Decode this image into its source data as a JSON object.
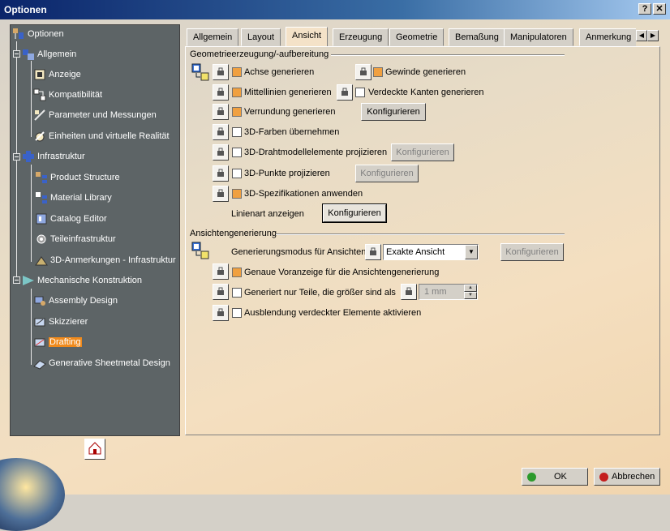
{
  "window": {
    "title": "Optionen",
    "help_button": "?",
    "close_button": "✕"
  },
  "tree": {
    "items": [
      {
        "label": "Optionen",
        "level": 0
      },
      {
        "label": "Allgemein",
        "level": 1
      },
      {
        "label": "Anzeige",
        "level": 2
      },
      {
        "label": "Kompatibilität",
        "level": 2
      },
      {
        "label": "Parameter und Messungen",
        "level": 2
      },
      {
        "label": "Einheiten und virtuelle Realität",
        "level": 2
      },
      {
        "label": "Infrastruktur",
        "level": 1
      },
      {
        "label": "Product Structure",
        "level": 2
      },
      {
        "label": "Material Library",
        "level": 2
      },
      {
        "label": "Catalog Editor",
        "level": 2
      },
      {
        "label": "Teileinfrastruktur",
        "level": 2
      },
      {
        "label": "3D-Anmerkungen - Infrastruktur",
        "level": 2
      },
      {
        "label": "Mechanische Konstruktion",
        "level": 1
      },
      {
        "label": "Assembly Design",
        "level": 2
      },
      {
        "label": "Skizzierer",
        "level": 2
      },
      {
        "label": "Drafting",
        "level": 2,
        "selected": true
      },
      {
        "label": "Generative Sheetmetal Design",
        "level": 2
      }
    ]
  },
  "tabs": [
    {
      "label": "Allgemein"
    },
    {
      "label": "Layout"
    },
    {
      "label": "Ansicht",
      "active": true
    },
    {
      "label": "Erzeugung"
    },
    {
      "label": "Geometrie"
    },
    {
      "label": "Bemaßung"
    },
    {
      "label": "Manipulatoren"
    },
    {
      "label": "Anmerkung"
    }
  ],
  "geometry_section": {
    "title": "Geometrieerzeugung/-aufbereitung",
    "options": {
      "achse": {
        "label": "Achse generieren",
        "checked": true
      },
      "gewinde": {
        "label": "Gewinde generieren",
        "checked": true
      },
      "mittellinien": {
        "label": "Mittellinien generieren",
        "checked": true
      },
      "verdeckte_kanten": {
        "label": "Verdeckte Kanten generieren",
        "checked": false
      },
      "verrundung": {
        "label": "Verrundung generieren",
        "checked": true
      },
      "farben": {
        "label": "3D-Farben übernehmen",
        "checked": false
      },
      "draht": {
        "label": "3D-Drahtmodellelemente projizieren",
        "checked": false
      },
      "punkte": {
        "label": "3D-Punkte projizieren",
        "checked": false
      },
      "spezifikationen": {
        "label": "3D-Spezifikationen anwenden",
        "checked": true
      }
    },
    "linienart_label": "Linienart anzeigen",
    "configure_label": "Konfigurieren"
  },
  "view_section": {
    "title": "Ansichtengenerierung",
    "mode_label": "Generierungsmodus für Ansichten",
    "mode_value": "Exakte Ansicht",
    "configure_label": "Konfigurieren",
    "options": {
      "voranzeige": {
        "label": "Genaue Voranzeige für die Ansichtengenerierung",
        "checked": true
      },
      "teile": {
        "label": "Generiert nur Teile, die größer sind als",
        "checked": false
      },
      "ausblendung": {
        "label": "Ausblendung verdeckter Elemente aktivieren",
        "checked": false
      }
    },
    "size_value": "1 mm"
  },
  "footer": {
    "ok_label": "OK",
    "cancel_label": "Abbrechen"
  },
  "colors": {
    "selected": "#f08a1c",
    "checked": "#f0a040",
    "tree_bg": "#5d6466",
    "ok_dot": "#2c9a2c",
    "cancel_dot": "#c41e1e"
  }
}
